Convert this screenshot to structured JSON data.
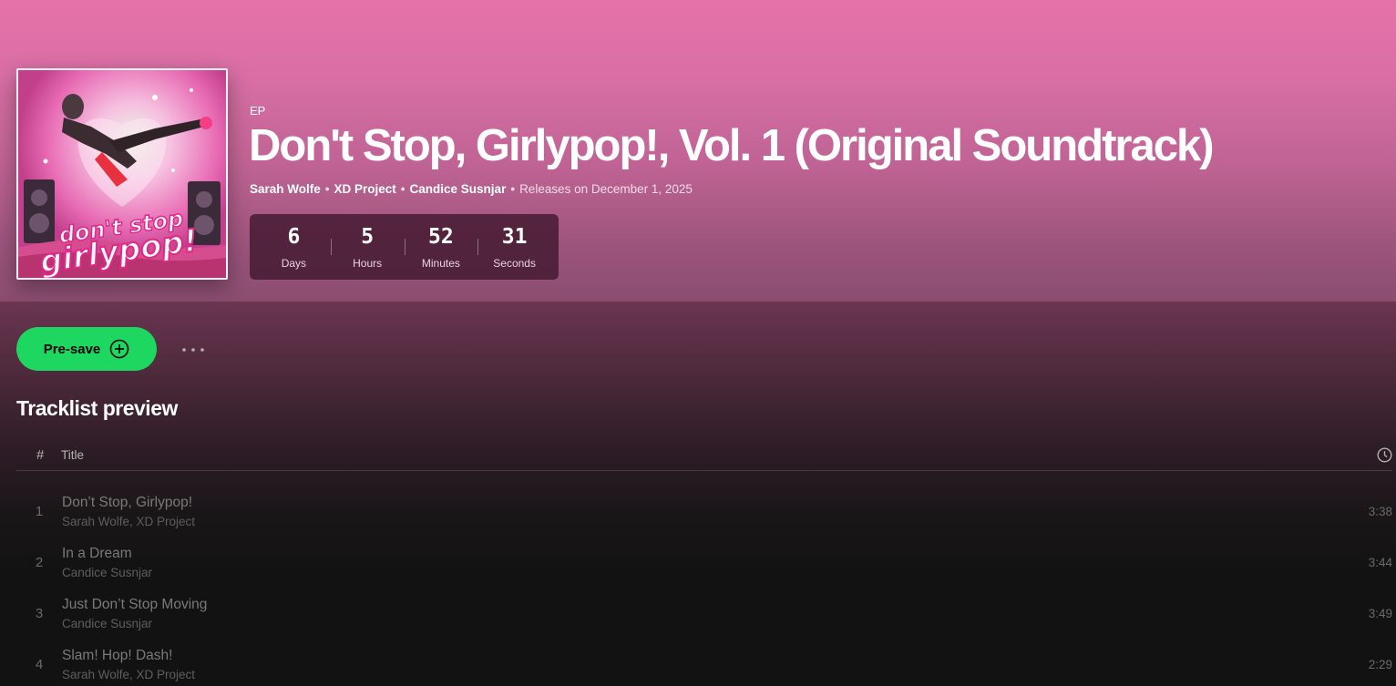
{
  "header": {
    "type_label": "EP",
    "title": "Don't Stop, Girlypop!, Vol. 1 (Original Soundtrack)",
    "artists": [
      "Sarah Wolfe",
      "XD Project",
      "Candice Susnjar"
    ],
    "separator": "•",
    "release_text": "Releases on December 1, 2025",
    "cover_logo_text": "don't stop girlypop!",
    "gradient_color": "#e672aa"
  },
  "countdown": {
    "days": {
      "value": "6",
      "label": "Days"
    },
    "hours": {
      "value": "5",
      "label": "Hours"
    },
    "minutes": {
      "value": "52",
      "label": "Minutes"
    },
    "seconds": {
      "value": "31",
      "label": "Seconds"
    }
  },
  "actions": {
    "presave_label": "Pre-save",
    "presave_icon": "plus-circle-icon",
    "more_icon": "more-options-icon",
    "accent_color": "#1ed760"
  },
  "tracklist": {
    "heading": "Tracklist preview",
    "columns": {
      "number": "#",
      "title": "Title",
      "duration_icon": "clock-icon"
    },
    "tracks": [
      {
        "number": "1",
        "title": "Don’t Stop, Girlypop!",
        "artists": "Sarah Wolfe, XD Project",
        "duration": "3:38"
      },
      {
        "number": "2",
        "title": "In a Dream",
        "artists": "Candice Susnjar",
        "duration": "3:44"
      },
      {
        "number": "3",
        "title": "Just Don’t Stop Moving",
        "artists": "Candice Susnjar",
        "duration": "3:49"
      },
      {
        "number": "4",
        "title": "Slam! Hop! Dash!",
        "artists": "Sarah Wolfe, XD Project",
        "duration": "2:29"
      }
    ]
  }
}
